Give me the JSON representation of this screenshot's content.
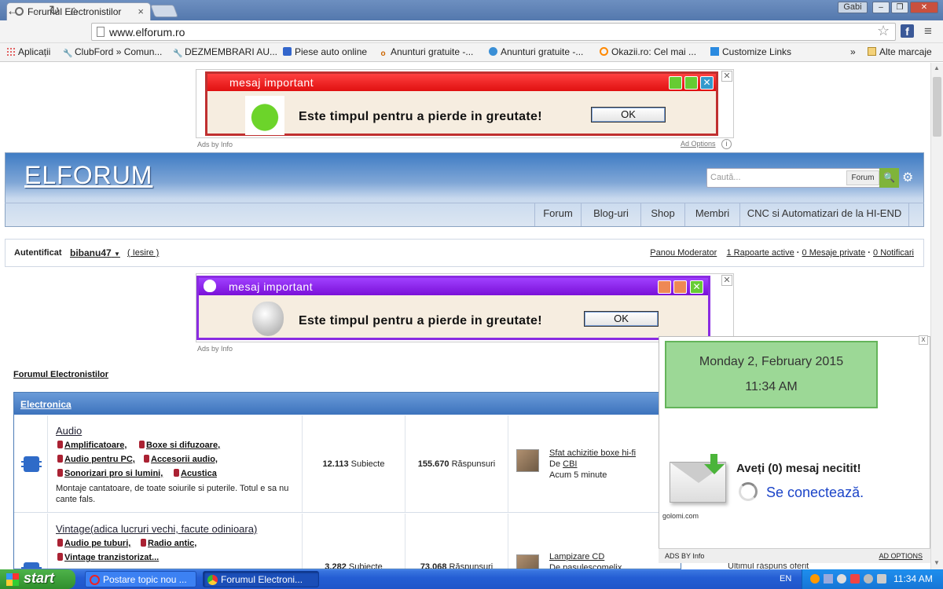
{
  "browser": {
    "tab_title": "Forumul Electronistilor",
    "user_badge": "Gabi",
    "url": "www.elforum.ro",
    "win_min": "–",
    "win_max": "❐",
    "win_close": "✕",
    "tab_close": "×"
  },
  "bookmarks": {
    "apps": "Aplicații",
    "items": [
      "ClubFord » Comun...",
      "DEZMEMBRARI AU...",
      "Piese auto online",
      "Anunturi gratuite -...",
      "Anunturi gratuite -...",
      "Okazii.ro: Cel mai ...",
      "Customize Links"
    ],
    "overflow": "»",
    "other": "Alte marcaje"
  },
  "ad1": {
    "title": "mesaj important",
    "text": "Este timpul pentru a pierde in greutate!",
    "ok": "OK",
    "ads_by": "Ads by Info",
    "ad_options": "Ad Options"
  },
  "ad2": {
    "title": "mesaj important",
    "text": "Este timpul pentru a pierde in greutate!",
    "ok": "OK",
    "ads_by": "Ads by Info"
  },
  "forum": {
    "logo": "ELFORUM",
    "search_placeholder": "Caută...",
    "search_scope": "Forum",
    "nav": [
      "Forum",
      "Blog-uri",
      "Shop",
      "Membri",
      "CNC si Automatizari de la HI-END"
    ],
    "auth_label": "Autentificat",
    "username": "bibanu47",
    "logout": "( Iesire )",
    "panel": "Panou Moderator",
    "reports": "1 Rapoarte active",
    "messages": "0 Mesaje private",
    "notifications": "0 Notificari",
    "sep": "·",
    "breadcrumb": "Forumul Electronistilor",
    "category": "Electronica"
  },
  "rows": [
    {
      "name": "Audio",
      "subs": [
        "Amplificatoare,",
        "Boxe si difuzoare,",
        "Audio pentru PC,",
        "Accesorii audio,",
        "Sonorizari pro si lumini,",
        "Acustica"
      ],
      "desc": "Montaje cantatoare, de toate soiurile si puterile. Totul e sa nu cante fals.",
      "topics": "12.113",
      "topics_label": "Subiecte",
      "replies": "155.670",
      "replies_label": "Răspunsuri",
      "last_title": "Sfat achizitie boxe hi-fi",
      "last_by": "De",
      "last_user": "CBI",
      "last_time": "Acum 5 minute"
    },
    {
      "name": "Vintage(adica lucruri vechi, facute odinioara)",
      "subs": [
        "Audio pe tuburi,",
        "Radio antic,",
        "Vintage tranzistorizat..."
      ],
      "topics": "3.282",
      "topics_label": "Subiecte",
      "replies": "73.068",
      "replies_label": "Răspunsuri",
      "last_title": "Lampizare CD",
      "last_by": "De pasulescomelix"
    }
  ],
  "widget": {
    "date": "Monday 2, February 2015",
    "time": "11:34 AM",
    "unread": "Aveți (0) mesaj necitit!",
    "connecting": "Se conectează.",
    "brand": "golomi.com",
    "ads_by": "ADS BY Info",
    "ad_options": "AD OPTIONS",
    "close": "x",
    "peek_text": "Ultimul răspuns oferit"
  },
  "taskbar": {
    "start": "start",
    "tasks": [
      "Postare topic nou ...",
      "Forumul Electroni..."
    ],
    "lang": "EN",
    "clock": "11:34 AM"
  }
}
